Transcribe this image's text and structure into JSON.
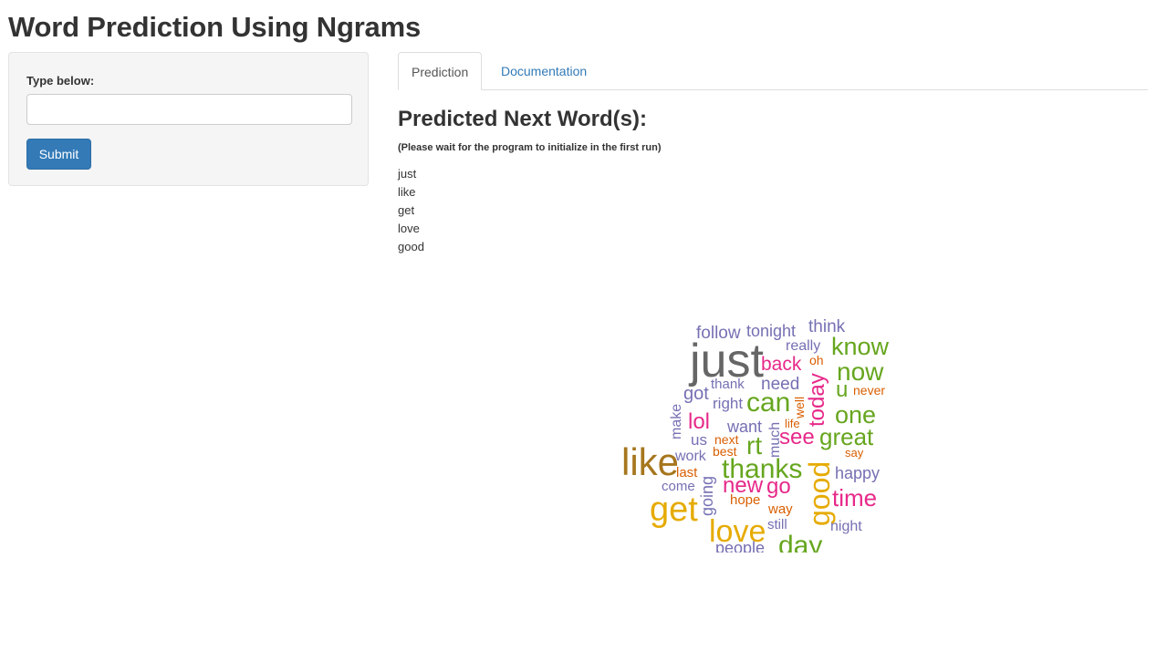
{
  "app": {
    "title": "Word Prediction Using Ngrams"
  },
  "sidebar": {
    "input_label": "Type below:",
    "input_value": "",
    "input_placeholder": "",
    "submit_label": "Submit"
  },
  "tabs": [
    {
      "label": "Prediction",
      "active": true
    },
    {
      "label": "Documentation",
      "active": false
    }
  ],
  "main": {
    "heading": "Predicted Next Word(s):",
    "note": "(Please wait for the program to initialize in the first run)",
    "predictions": [
      "just",
      "like",
      "get",
      "love",
      "good"
    ]
  },
  "colors": {
    "primary": "#337ab7",
    "cloud_gray": "#666666",
    "cloud_purple": "#7570b3",
    "cloud_green": "#66a61e",
    "cloud_pink": "#e7298a",
    "cloud_orange": "#d95f02",
    "cloud_gold": "#e6ab02",
    "cloud_brown": "#a6761d"
  },
  "wordcloud": {
    "words": [
      {
        "text": "just",
        "color": "#666666",
        "vertical": false
      },
      {
        "text": "like",
        "color": "#a6761d",
        "vertical": false
      },
      {
        "text": "get",
        "color": "#e6ab02",
        "vertical": false
      },
      {
        "text": "love",
        "color": "#e6ab02",
        "vertical": false
      },
      {
        "text": "good",
        "color": "#e6ab02",
        "vertical": true
      },
      {
        "text": "day",
        "color": "#66a61e",
        "vertical": false
      },
      {
        "text": "thanks",
        "color": "#66a61e",
        "vertical": false
      },
      {
        "text": "can",
        "color": "#66a61e",
        "vertical": false
      },
      {
        "text": "know",
        "color": "#66a61e",
        "vertical": false
      },
      {
        "text": "now",
        "color": "#66a61e",
        "vertical": false
      },
      {
        "text": "one",
        "color": "#66a61e",
        "vertical": false
      },
      {
        "text": "great",
        "color": "#66a61e",
        "vertical": false
      },
      {
        "text": "rt",
        "color": "#66a61e",
        "vertical": false
      },
      {
        "text": "u",
        "color": "#66a61e",
        "vertical": false
      },
      {
        "text": "time",
        "color": "#e7298a",
        "vertical": false
      },
      {
        "text": "lol",
        "color": "#e7298a",
        "vertical": false
      },
      {
        "text": "see",
        "color": "#e7298a",
        "vertical": false
      },
      {
        "text": "new",
        "color": "#e7298a",
        "vertical": false
      },
      {
        "text": "go",
        "color": "#e7298a",
        "vertical": false
      },
      {
        "text": "back",
        "color": "#e7298a",
        "vertical": false
      },
      {
        "text": "today",
        "color": "#e7298a",
        "vertical": true
      },
      {
        "text": "follow",
        "color": "#7570b3",
        "vertical": false
      },
      {
        "text": "tonight",
        "color": "#7570b3",
        "vertical": false
      },
      {
        "text": "think",
        "color": "#7570b3",
        "vertical": false
      },
      {
        "text": "really",
        "color": "#7570b3",
        "vertical": false
      },
      {
        "text": "thank",
        "color": "#7570b3",
        "vertical": false
      },
      {
        "text": "need",
        "color": "#7570b3",
        "vertical": false
      },
      {
        "text": "got",
        "color": "#7570b3",
        "vertical": false
      },
      {
        "text": "right",
        "color": "#7570b3",
        "vertical": false
      },
      {
        "text": "want",
        "color": "#7570b3",
        "vertical": false
      },
      {
        "text": "us",
        "color": "#7570b3",
        "vertical": false
      },
      {
        "text": "work",
        "color": "#7570b3",
        "vertical": false
      },
      {
        "text": "happy",
        "color": "#7570b3",
        "vertical": false
      },
      {
        "text": "come",
        "color": "#7570b3",
        "vertical": false
      },
      {
        "text": "still",
        "color": "#7570b3",
        "vertical": false
      },
      {
        "text": "night",
        "color": "#7570b3",
        "vertical": false
      },
      {
        "text": "people",
        "color": "#7570b3",
        "vertical": false
      },
      {
        "text": "make",
        "color": "#7570b3",
        "vertical": true
      },
      {
        "text": "much",
        "color": "#7570b3",
        "vertical": true
      },
      {
        "text": "going",
        "color": "#7570b3",
        "vertical": true
      },
      {
        "text": "oh",
        "color": "#d95f02",
        "vertical": false
      },
      {
        "text": "never",
        "color": "#d95f02",
        "vertical": false
      },
      {
        "text": "life",
        "color": "#d95f02",
        "vertical": false
      },
      {
        "text": "next",
        "color": "#d95f02",
        "vertical": false
      },
      {
        "text": "best",
        "color": "#d95f02",
        "vertical": false
      },
      {
        "text": "say",
        "color": "#d95f02",
        "vertical": false
      },
      {
        "text": "last",
        "color": "#d95f02",
        "vertical": false
      },
      {
        "text": "hope",
        "color": "#d95f02",
        "vertical": false
      },
      {
        "text": "way",
        "color": "#d95f02",
        "vertical": false
      },
      {
        "text": "well",
        "color": "#d95f02",
        "vertical": true
      }
    ]
  }
}
